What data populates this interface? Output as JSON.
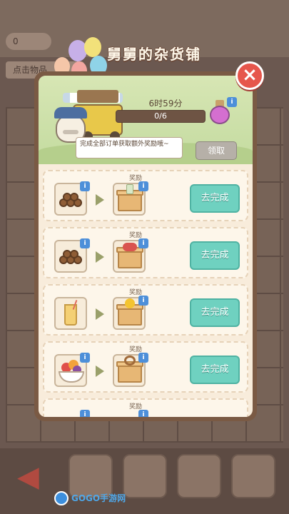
{
  "shop": {
    "title": "舅舅的杂货铺",
    "close_label": "×",
    "timer": "6时59分",
    "progress_text": "0/6",
    "progress_fraction": 0.0,
    "hint": "完成全部订单获取额外奖励哦~",
    "claim_label": "领取"
  },
  "orders": [
    {
      "reward_label": "奖励",
      "input_item": "log-bundle",
      "reward_item": "box-bottle",
      "button_label": "去完成"
    },
    {
      "reward_label": "奖励",
      "input_item": "log-bundle",
      "reward_item": "box-meat",
      "button_label": "去完成"
    },
    {
      "reward_label": "奖励",
      "input_item": "juice-glass",
      "reward_item": "box-duck",
      "button_label": "去完成"
    },
    {
      "reward_label": "奖励",
      "input_item": "fruit-bowl",
      "reward_item": "box-ring",
      "button_label": "去完成"
    },
    {
      "reward_label": "奖励"
    }
  ],
  "background": {
    "stat_left": "0",
    "stat_truncated": "点击物品"
  },
  "watermark": {
    "text": "GOGO手游网"
  },
  "colors": {
    "go_button": "#6fd1c0",
    "close_button": "#e6564c",
    "info_badge": "#4d8fd9",
    "panel_border": "#7a5a44",
    "claim_button": "#b6b0a8"
  },
  "icons": {
    "close": "close-icon",
    "info": "info-icon",
    "arrow": "arrow-right-icon",
    "back": "back-arrow-icon"
  }
}
